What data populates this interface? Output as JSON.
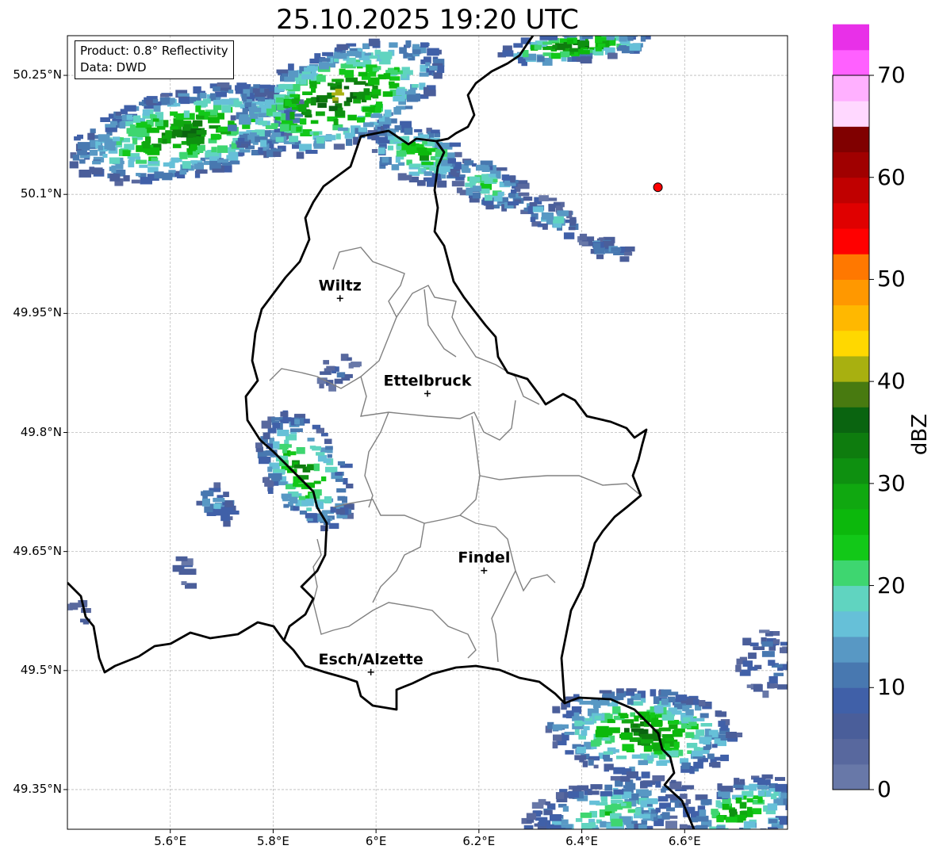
{
  "title": "25.10.2025 19:20 UTC",
  "info": {
    "product": "Product: 0.8° Reflectivity",
    "data": "Data: DWD"
  },
  "axes": {
    "lat_labels": [
      "50.25°N",
      "50.1°N",
      "49.95°N",
      "49.8°N",
      "49.65°N",
      "49.5°N",
      "49.35°N"
    ],
    "lat_values": [
      50.25,
      50.1,
      49.95,
      49.8,
      49.65,
      49.5,
      49.35
    ],
    "lon_labels": [
      "5.6°E",
      "5.8°E",
      "6°E",
      "6.2°E",
      "6.4°E",
      "6.6°E"
    ],
    "lon_values": [
      5.6,
      5.8,
      6.0,
      6.2,
      6.4,
      6.6
    ],
    "lon_range": [
      5.4,
      6.8
    ],
    "lat_range": [
      49.3,
      50.3
    ]
  },
  "cities": [
    {
      "name": "Wiltz",
      "lon": 5.93,
      "lat": 49.969
    },
    {
      "name": "Ettelbruck",
      "lon": 6.1,
      "lat": 49.849
    },
    {
      "name": "Findel",
      "lon": 6.21,
      "lat": 49.626
    },
    {
      "name": "Esch/Alzette",
      "lon": 5.99,
      "lat": 49.498
    }
  ],
  "radar_site": {
    "lon": 6.548,
    "lat": 50.109,
    "color": "#ff0000"
  },
  "colorbar": {
    "label": "dBZ",
    "tick_labels": [
      "0",
      "10",
      "20",
      "30",
      "40",
      "50",
      "60",
      "70"
    ],
    "min": 0,
    "max": 70,
    "step": 2.5,
    "colors": [
      "#6878a8",
      "#58689e",
      "#4a5e9a",
      "#4060a8",
      "#4878b0",
      "#5898c4",
      "#66c0d8",
      "#60d4c0",
      "#3ed670",
      "#12c818",
      "#0cb80c",
      "#10a810",
      "#0e9010",
      "#0e7c0e",
      "#0a6410",
      "#487a10",
      "#a8b010",
      "#ffd800",
      "#ffb800",
      "#ff9800",
      "#ff7800",
      "#ff0000",
      "#e00000",
      "#c00000",
      "#a00000",
      "#800000",
      "#ffd8ff",
      "#ffb0ff",
      "#ff60ff",
      "#e830e8"
    ]
  }
}
